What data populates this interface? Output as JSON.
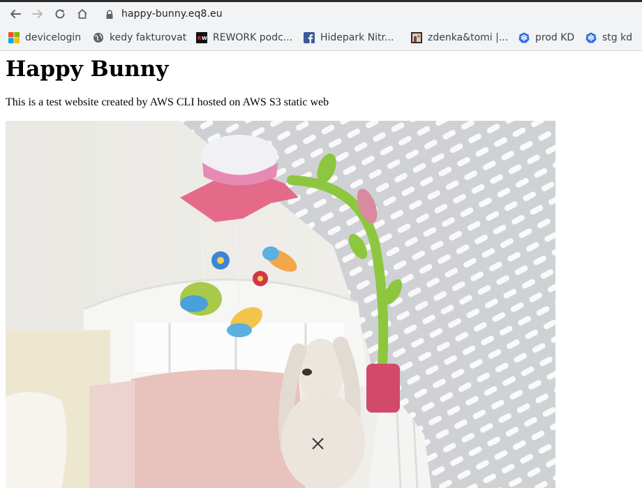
{
  "browser": {
    "url": "happy-bunny.eq8.eu",
    "bookmarks": [
      {
        "label": "devicelogin",
        "icon": "microsoft-icon"
      },
      {
        "label": "kedy fakturovat",
        "icon": "globe-icon"
      },
      {
        "label": "REWORK podc...",
        "icon": "rework-icon"
      },
      {
        "label": "Hidepark Nitr...",
        "icon": "facebook-icon"
      },
      {
        "label": "zdenka&tomi |...",
        "icon": "photo-icon"
      },
      {
        "label": "prod KD",
        "icon": "kubernetes-icon"
      },
      {
        "label": "stg kd",
        "icon": "kubernetes-icon"
      }
    ]
  },
  "page": {
    "title": "Happy Bunny",
    "description": "This is a test website created by AWS CLI hosted on AWS S3 static web",
    "image": {
      "subject": "crib-mobile-with-plush-bunny",
      "colors": {
        "wall": "#e8e6e0",
        "flower": "#e56a8a",
        "arm": "#8dc63f",
        "bunny": "#ece6df",
        "cushion": "#e8c2bd"
      }
    }
  }
}
